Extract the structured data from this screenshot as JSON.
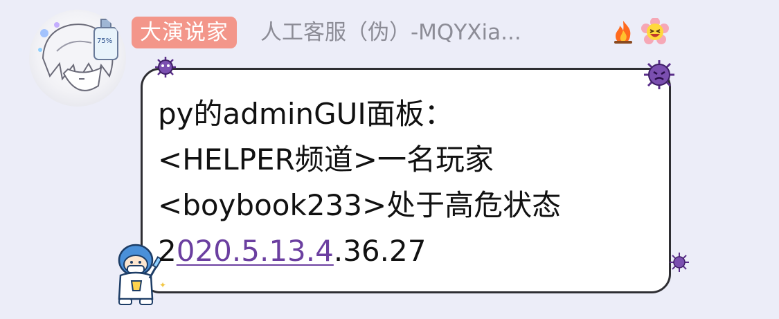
{
  "sender": {
    "title_badge": "大演说家",
    "name": "人工客服（伪）-MQYXia...",
    "avatar_icon": "anime-avatar-icon",
    "badge_icons": [
      "fire-icon",
      "flower-laugh-icon"
    ]
  },
  "message": {
    "line1": "py的adminGUI面板：",
    "line2": "<HELPER频道>一名玩家",
    "line3": "<boybook233>处于高危状态",
    "line4_prefix": "2",
    "line4_link": "020.5.13.4",
    "line4_suffix": ".36.27"
  },
  "colors": {
    "background": "#ecedf8",
    "badge": "#f3968a",
    "name_text": "#8c8c96",
    "link": "#6b3fa0",
    "bubble_border": "#2e2e33",
    "virus": "#7b4fb0"
  }
}
